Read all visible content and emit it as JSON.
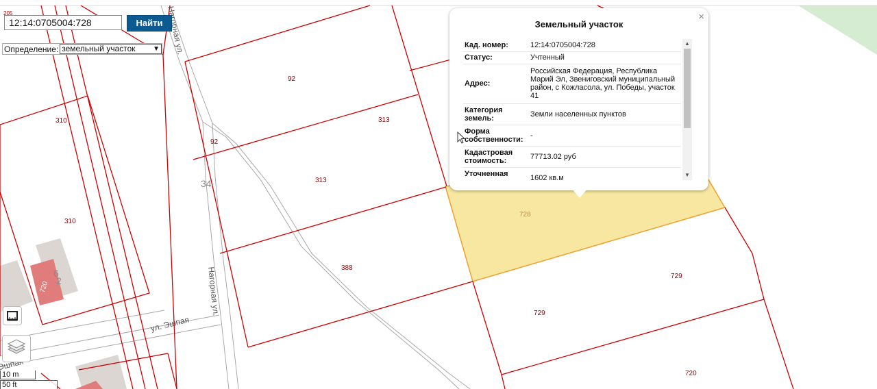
{
  "search": {
    "value": "12:14:0705004:728",
    "button_label": "Найти"
  },
  "definition": {
    "label": "Определение:",
    "selected": "земельный участок"
  },
  "map": {
    "parcel_labels": [
      "205",
      "92",
      "313",
      "92",
      "313",
      "388",
      "310",
      "310",
      "728",
      "729",
      "729",
      "720",
      "720",
      "6",
      "2",
      "34"
    ],
    "street_labels": [
      "Нагорная ул.",
      "Нагорная ул.",
      "ул. Эшпая",
      "Эшпая"
    ]
  },
  "popup": {
    "title": "Земельный участок",
    "close": "×",
    "rows": [
      {
        "key": "Кад. номер:",
        "value": "12:14:0705004:728"
      },
      {
        "key": "Статус:",
        "value": "Учтенный"
      },
      {
        "key": "Адрес:",
        "value": "Российская Федерация, Республика Марий Эл, Звениговский муниципальный район, с Кожласола, ул. Победы, участок 41"
      },
      {
        "key": "Категория земель:",
        "value": "Земли населенных пунктов"
      },
      {
        "key": "Форма собственности:",
        "value": "-"
      },
      {
        "key": "Кадастровая стоимость:",
        "value": "77713.02 руб"
      },
      {
        "key": "Уточненная площадь:",
        "value": "1602 кв.м"
      }
    ]
  },
  "scale": {
    "metric": "10 m",
    "imperial": "50 ft"
  },
  "colors": {
    "parcel_border": "#cc0000",
    "selected_fill": "#f7e7a0",
    "selected_border": "#f0a030",
    "road": "#a8a8a8",
    "button": "#0d5a93"
  }
}
